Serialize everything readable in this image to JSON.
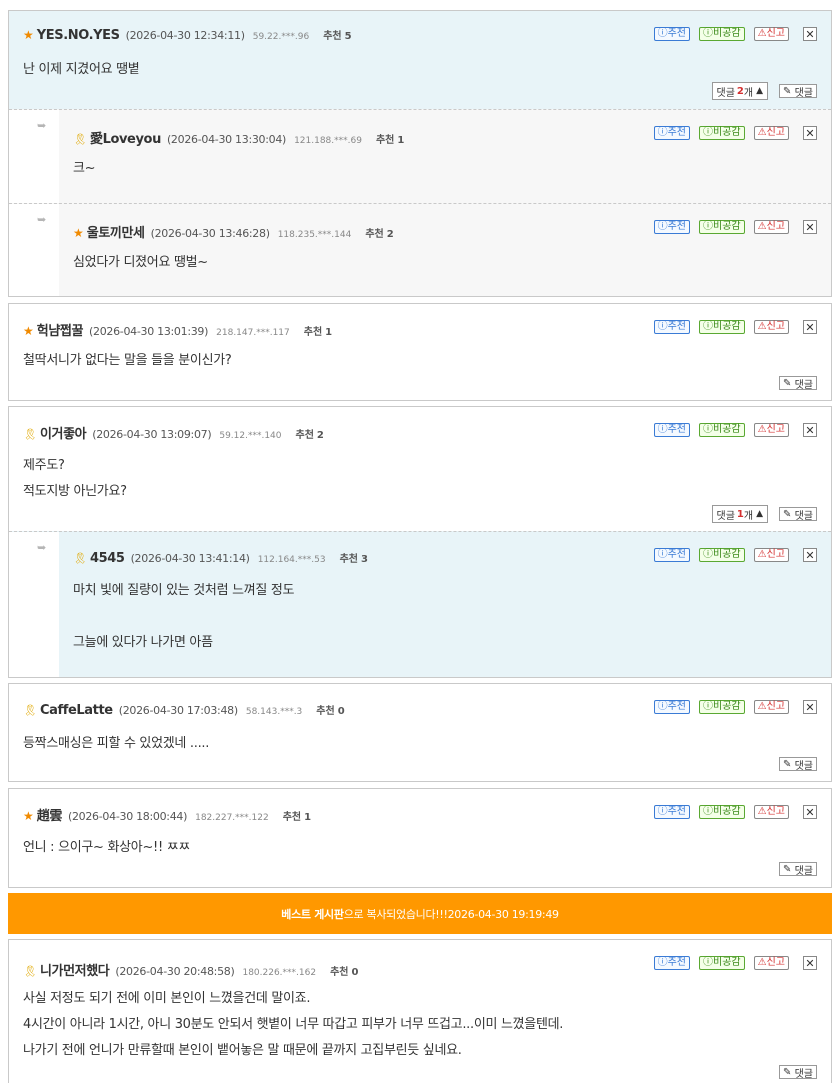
{
  "ui": {
    "recommend_btn": "ⓘ추천",
    "not_recommend_btn": "ⓘ비공감",
    "report_btn": "신고",
    "close_btn": "✕",
    "reply_btn": "댓글",
    "reply_count_prefix": "댓글",
    "reply_count_suffix": "개",
    "recommend_label": "추천",
    "reply_arrow": "➥"
  },
  "comments": [
    {
      "nick": "YES.NO.YES",
      "badge": "star",
      "date": "(2026-04-30 12:34:11)",
      "ip": "59.22.***.96",
      "rec": "5",
      "lines": [
        "난 이제 지겼어요 땡볕"
      ],
      "reply_count": "2"
    },
    {
      "nick": "愛Loveyou",
      "badge": "ribbon",
      "date": "(2026-04-30 13:30:04)",
      "ip": "121.188.***.69",
      "rec": "1",
      "lines": [
        "크~"
      ]
    },
    {
      "nick": "울토끼만세",
      "badge": "star",
      "date": "(2026-04-30 13:46:28)",
      "ip": "118.235.***.144",
      "rec": "2",
      "lines": [
        "심었다가 디졌어요 땡벌~"
      ]
    },
    {
      "nick": "헉냠쩝꿀",
      "badge": "star",
      "date": "(2026-04-30 13:01:39)",
      "ip": "218.147.***.117",
      "rec": "1",
      "lines": [
        "철딱서니가 없다는 말을 들을 분이신가?"
      ]
    },
    {
      "nick": "이거좋아",
      "badge": "ribbon",
      "date": "(2026-04-30 13:09:07)",
      "ip": "59.12.***.140",
      "rec": "2",
      "lines": [
        "제주도?",
        "적도지방 아닌가요?"
      ],
      "reply_count": "1"
    },
    {
      "nick": "4545",
      "badge": "ribbon",
      "date": "(2026-04-30 13:41:14)",
      "ip": "112.164.***.53",
      "rec": "3",
      "lines": [
        "마치 빛에 질량이 있는 것처럼 느껴질 정도",
        "",
        "그늘에 있다가 나가면 아픔"
      ]
    },
    {
      "nick": "CaffeLatte",
      "badge": "ribbon",
      "date": "(2026-04-30 17:03:48)",
      "ip": "58.143.***.3",
      "rec": "0",
      "lines": [
        "등짝스매싱은 피할 수 있었겠네 ....."
      ]
    },
    {
      "nick": "趙雲",
      "badge": "star",
      "date": "(2026-04-30 18:00:44)",
      "ip": "182.227.***.122",
      "rec": "1",
      "lines": [
        "언니 : 으이구~ 화상아~!! ㅉㅉ"
      ]
    },
    {
      "nick": "니가먼저했다",
      "badge": "ribbon",
      "date": "(2026-04-30 20:48:58)",
      "ip": "180.226.***.162",
      "rec": "0",
      "lines": [
        "사실 저정도 되기 전에 이미 본인이 느꼈을건데 말이죠.",
        "4시간이 아니라 1시간, 아니 30분도 안되서 햇볕이 너무 따갑고 피부가 너무 뜨겁고...이미 느꼈을텐데.",
        "나가기 전에 언니가 만류할때 본인이 뱉어놓은 말 때문에 끝까지 고집부린듯 싶네요."
      ]
    }
  ],
  "banner": {
    "board": "베스트 게시판",
    "text": "으로 복사되었습니다!!!2026-04-30 19:19:49"
  }
}
